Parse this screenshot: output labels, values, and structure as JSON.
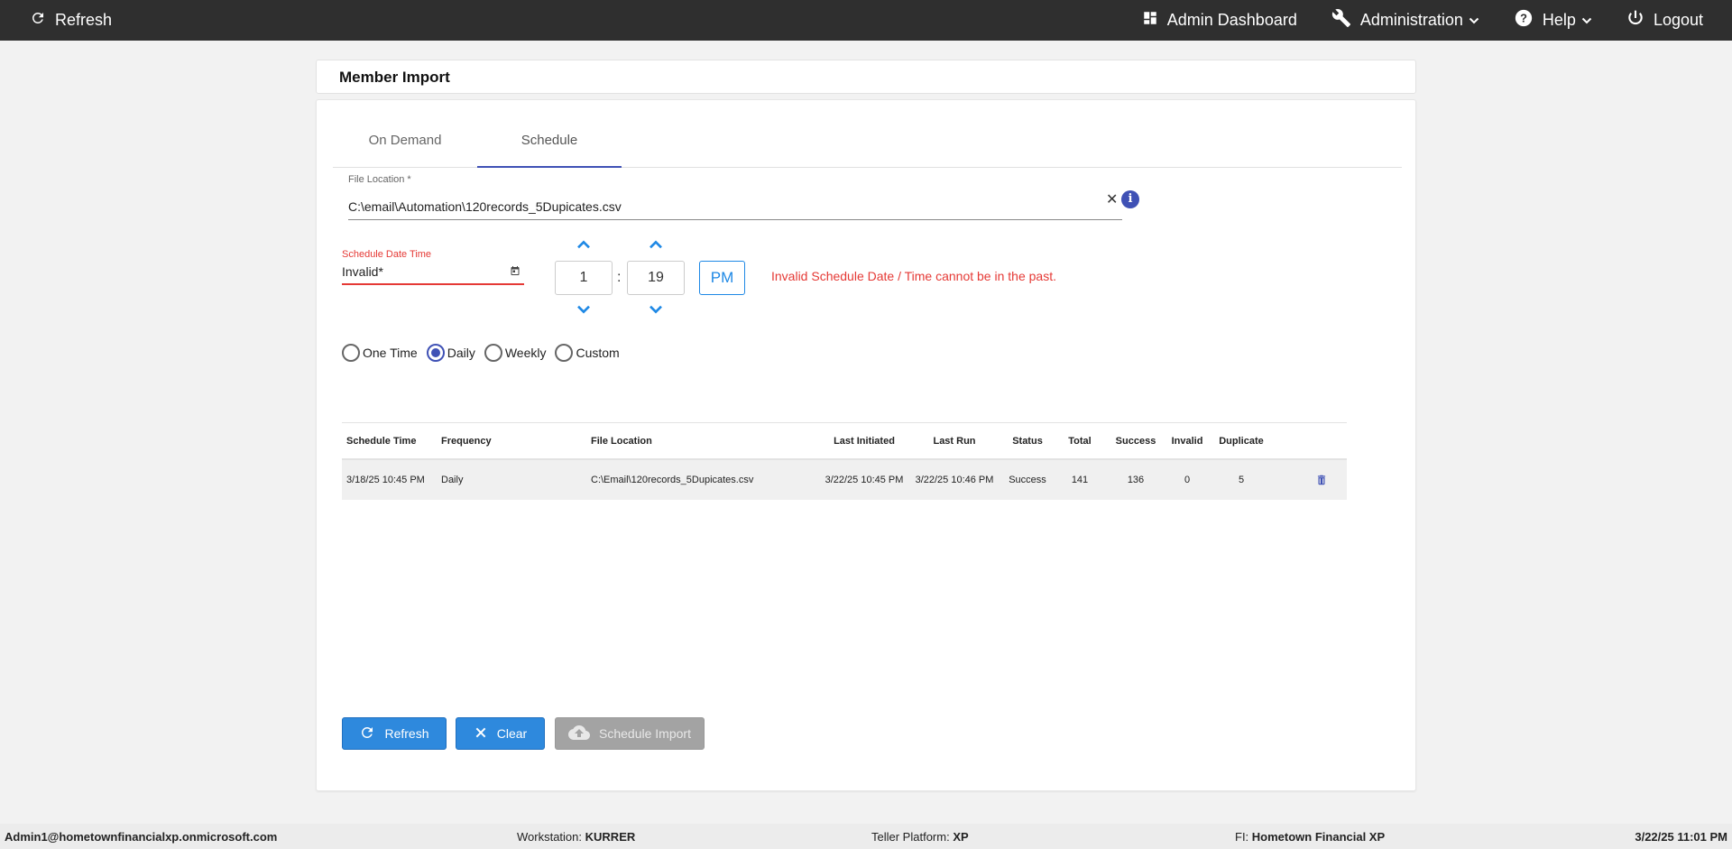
{
  "topbar": {
    "refresh_label": "Refresh",
    "admin_dashboard_label": "Admin Dashboard",
    "administration_label": "Administration",
    "help_label": "Help",
    "logout_label": "Logout"
  },
  "page": {
    "title": "Member Import"
  },
  "tabs": [
    {
      "label": "On Demand",
      "active": false
    },
    {
      "label": "Schedule",
      "active": true
    }
  ],
  "form": {
    "file_location_label": "File Location *",
    "file_location_value": "C:\\email\\Automation\\120records_5Dupicates.csv",
    "schedule_date_label": "Schedule Date Time",
    "schedule_date_value": "Invalid*",
    "hour": "1",
    "minute": "19",
    "ampm": "PM",
    "error_message": "Invalid Schedule Date / Time cannot be in the past.",
    "frequency_options": [
      {
        "label": "One Time",
        "checked": false
      },
      {
        "label": "Daily",
        "checked": true
      },
      {
        "label": "Weekly",
        "checked": false
      },
      {
        "label": "Custom",
        "checked": false
      }
    ]
  },
  "table": {
    "headers": [
      "Schedule Time",
      "Frequency",
      "File Location",
      "Last Initiated",
      "Last Run",
      "Status",
      "Total",
      "Success",
      "Invalid",
      "Duplicate"
    ],
    "rows": [
      {
        "schedule_time": "3/18/25 10:45 PM",
        "frequency": "Daily",
        "file_location": "C:\\Email\\120records_5Dupicates.csv",
        "last_initiated": "3/22/25 10:45 PM",
        "last_run": "3/22/25 10:46 PM",
        "status": "Success",
        "total": "141",
        "success": "136",
        "invalid": "0",
        "duplicate": "5"
      }
    ]
  },
  "buttons": {
    "refresh": "Refresh",
    "clear": "Clear",
    "schedule_import": "Schedule Import"
  },
  "footer": {
    "user": "Admin1@hometownfinancialxp.onmicrosoft.com",
    "workstation_label": "Workstation:",
    "workstation_value": "KURRER",
    "platform_label": "Teller Platform:",
    "platform_value": "XP",
    "fi_label": "FI:",
    "fi_value": "Hometown Financial XP",
    "datetime": "3/22/25 11:01 PM"
  },
  "colors": {
    "accent": "#3f51b5",
    "primary_button": "#2e89dd",
    "error": "#e53935",
    "topbar": "#2f2f2f"
  }
}
